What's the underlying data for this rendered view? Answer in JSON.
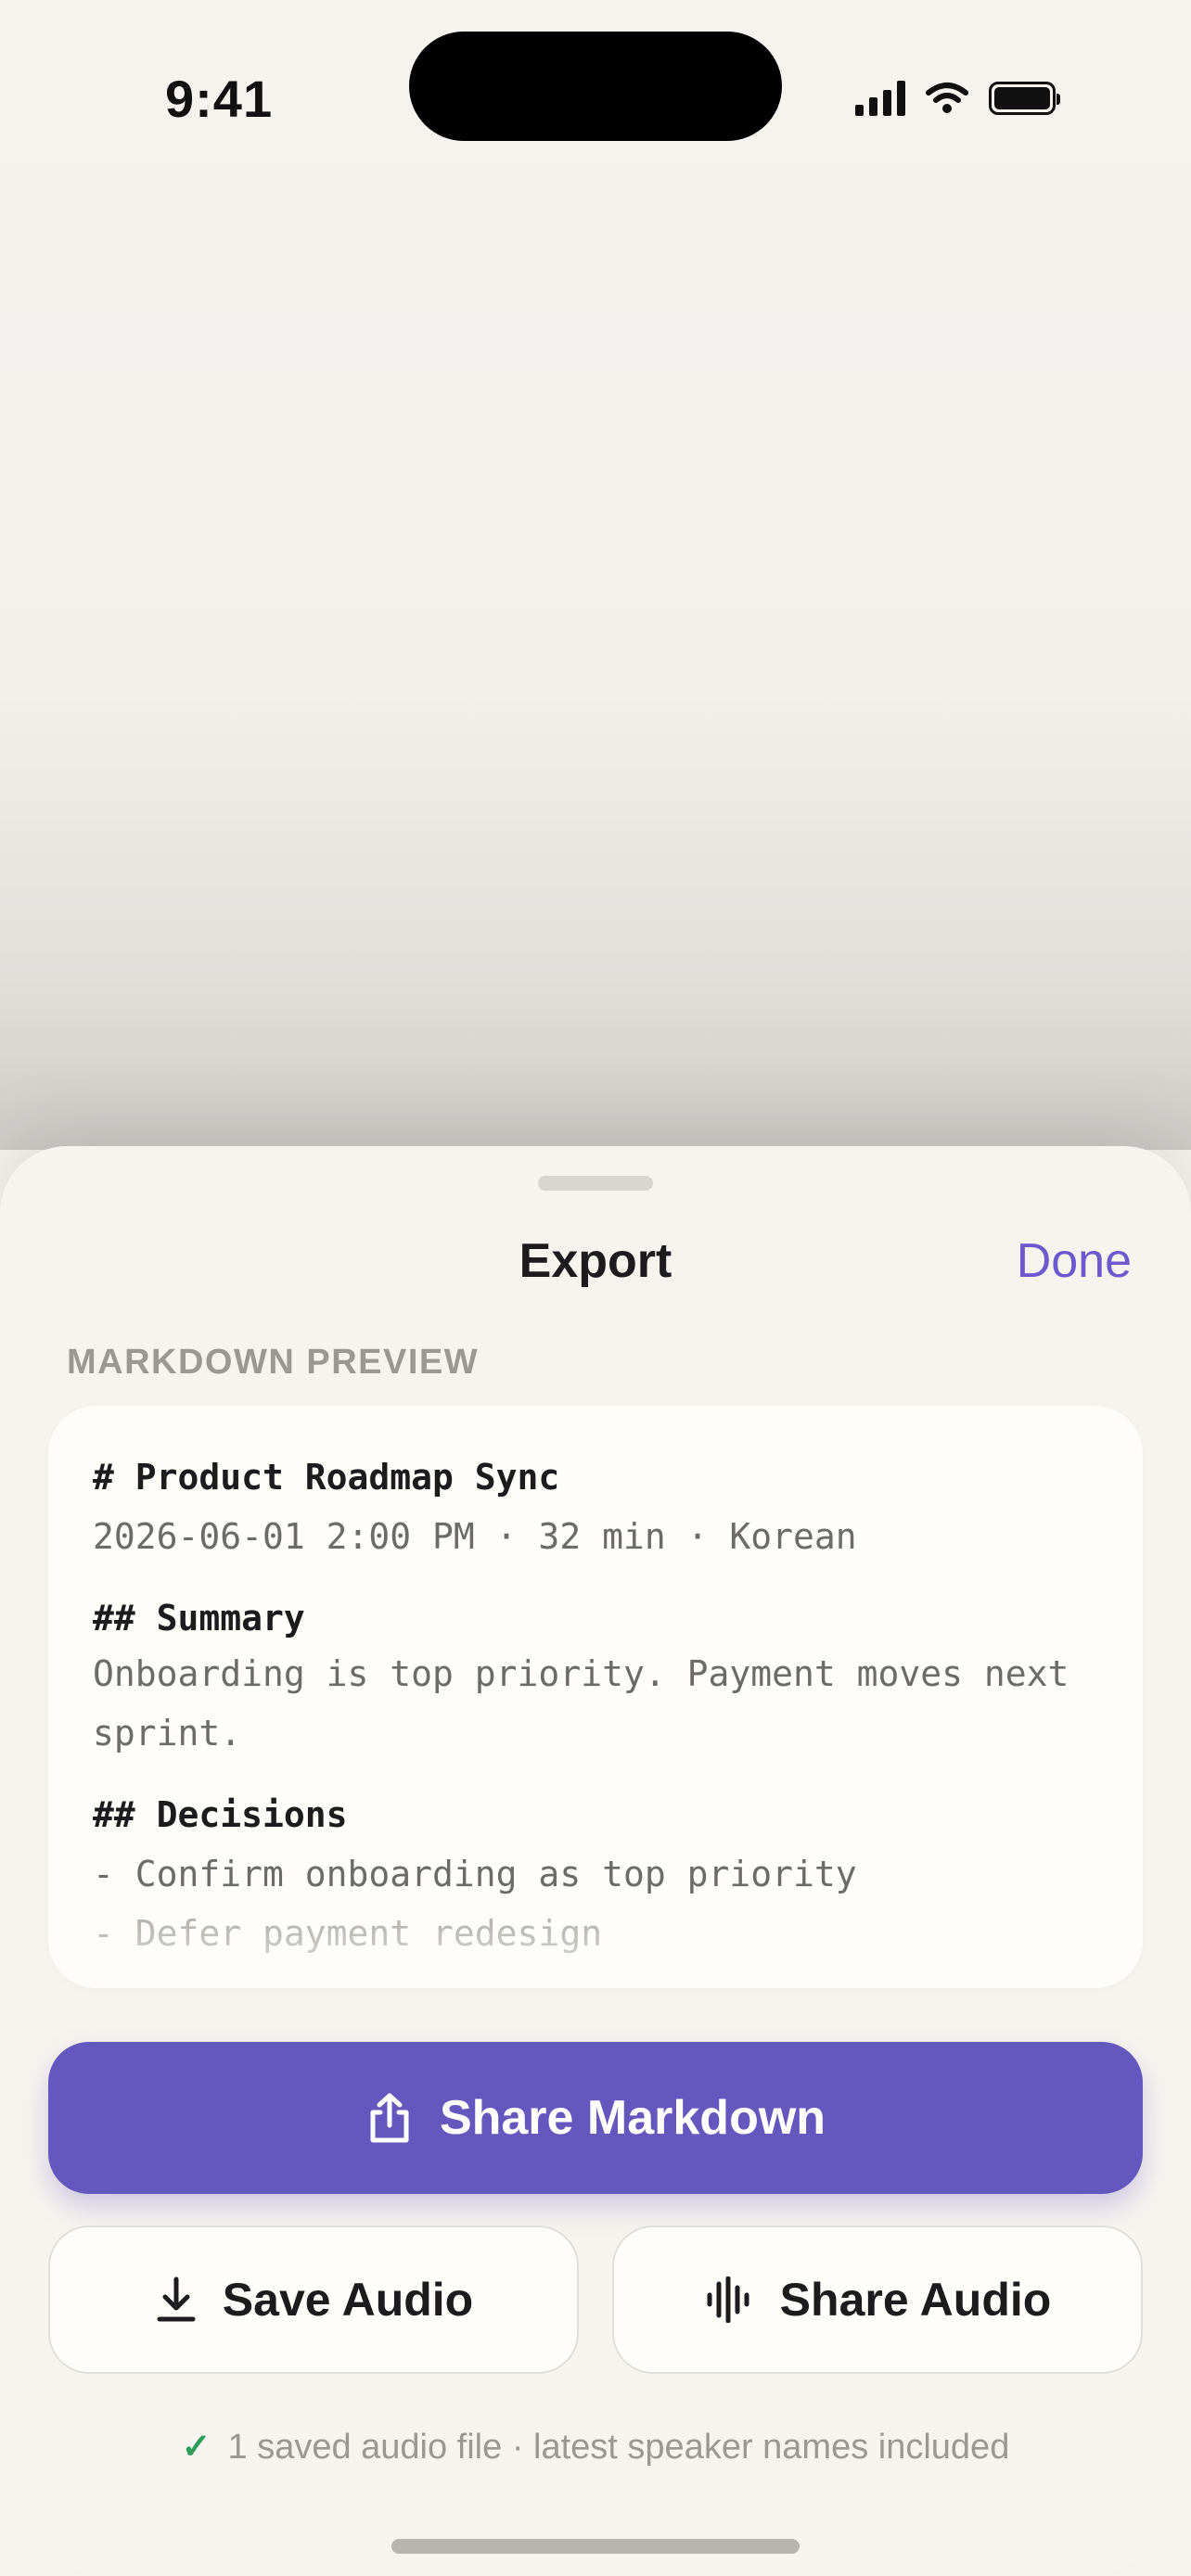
{
  "status_bar": {
    "time": "9:41"
  },
  "sheet": {
    "title": "Export",
    "done_label": "Done",
    "section_label": "MARKDOWN PREVIEW"
  },
  "preview": {
    "lines": [
      "# Product Roadmap Sync",
      "2026-06-01 2:00 PM · 32 min · Korean",
      "## Summary",
      "Onboarding is top priority. Payment moves next",
      "sprint.",
      "## Decisions",
      "- Confirm onboarding as top priority",
      "- Defer payment redesign"
    ]
  },
  "actions": {
    "share_markdown": "Share Markdown",
    "save_audio": "Save Audio",
    "share_audio": "Share Audio"
  },
  "footnote": "1 saved audio file · latest speaker names included",
  "colors": {
    "accent": "#6457bd",
    "done": "#6a5acd",
    "check": "#2e9e5b"
  },
  "icons": {
    "share": "share-icon",
    "download": "download-icon",
    "waveform": "waveform-icon",
    "check": "checkmark-icon"
  }
}
